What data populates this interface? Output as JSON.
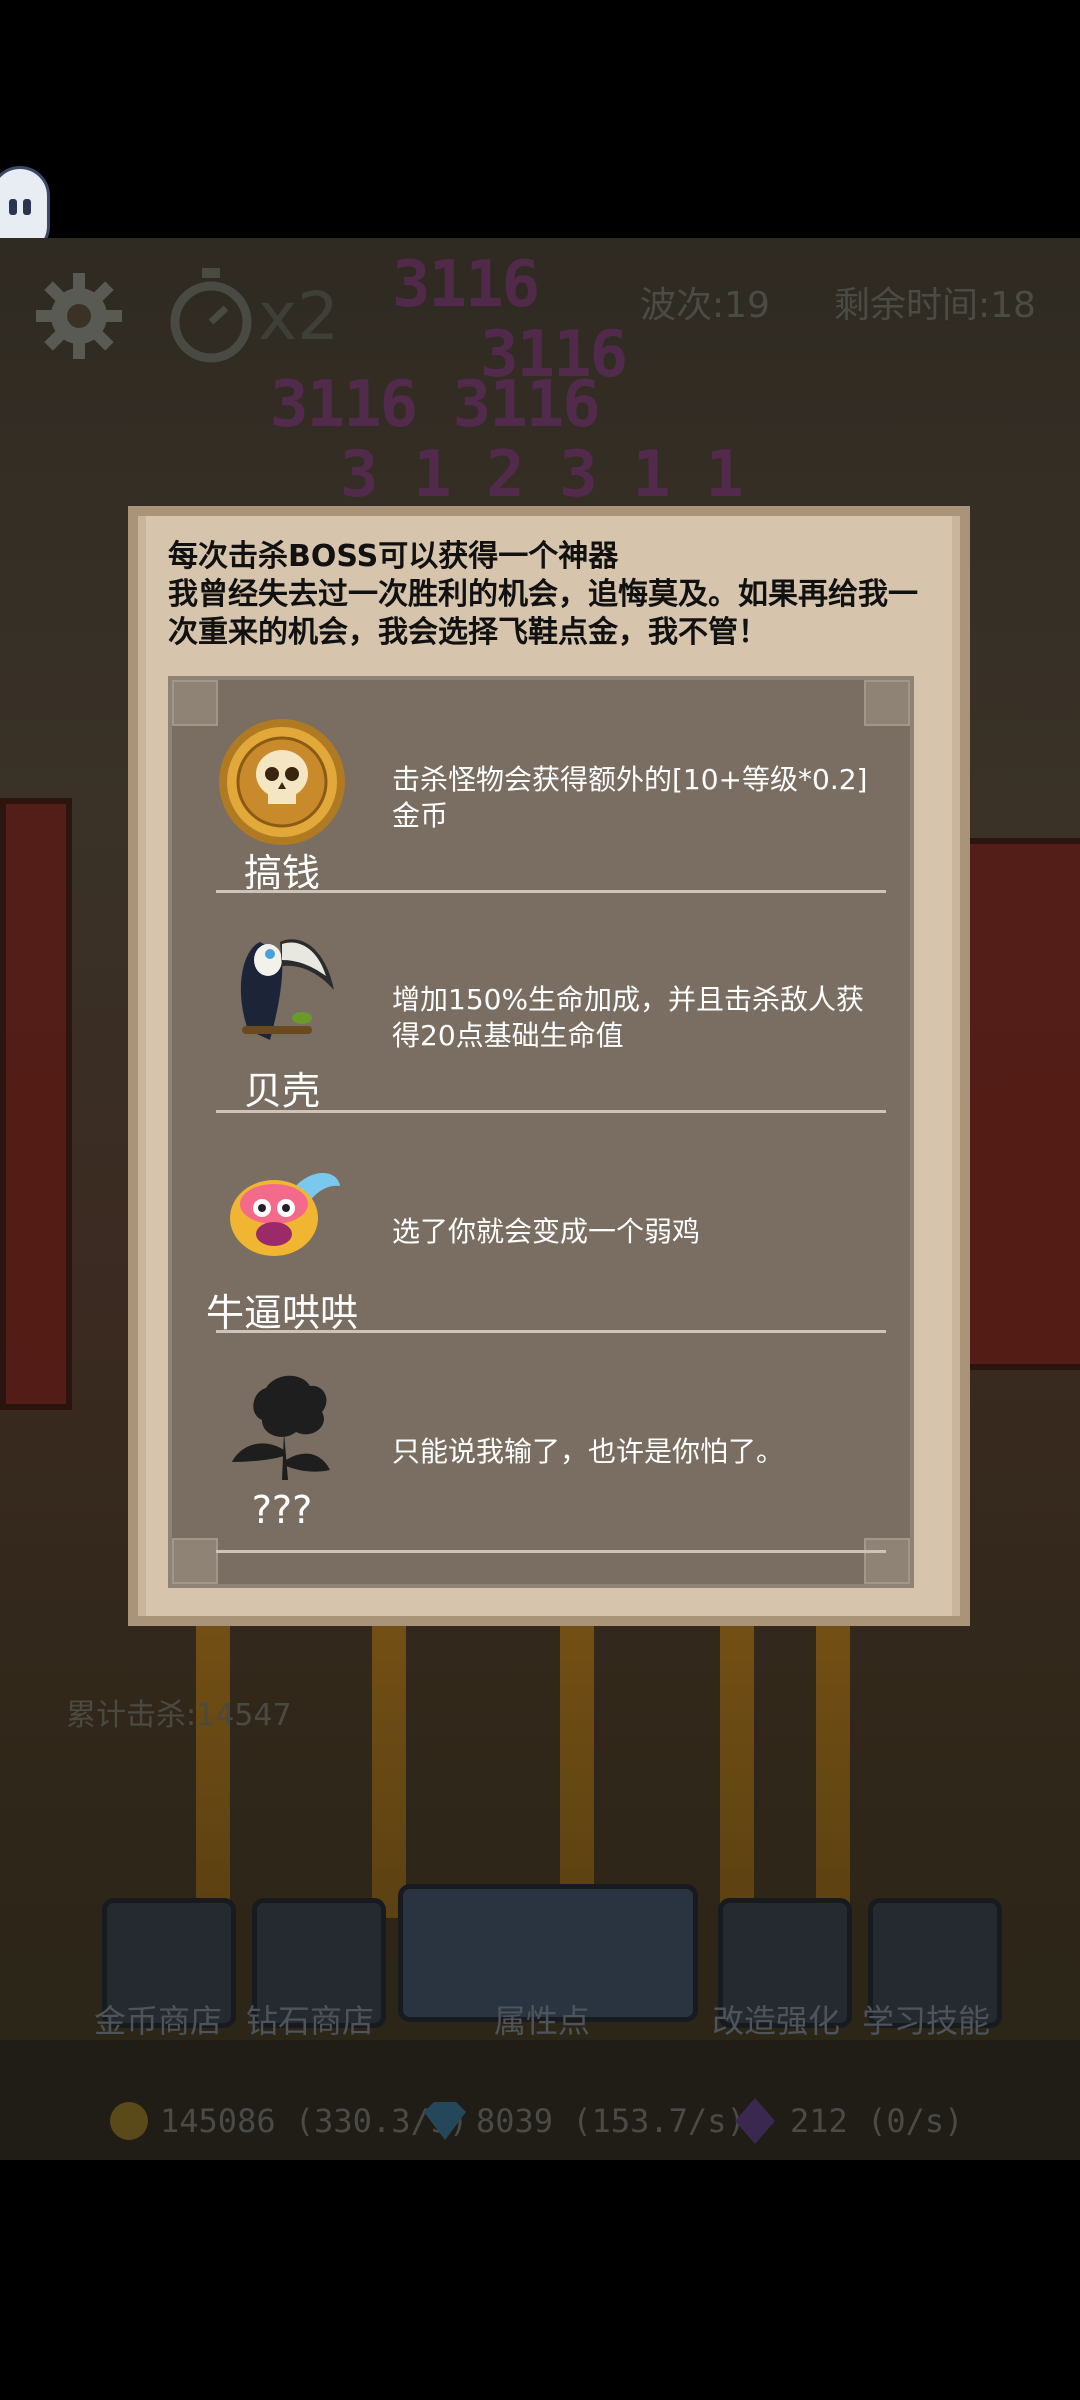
{
  "hud": {
    "speed_label": "x2",
    "wave_label": "波次:19",
    "time_label": "剩余时间:18",
    "kill_label": "累计击杀:14547"
  },
  "bottom_nav": {
    "items": [
      {
        "label": "金币商店"
      },
      {
        "label": "钻石商店"
      },
      {
        "label": "属性点"
      },
      {
        "label": "改造强化"
      },
      {
        "label": "学习技能"
      }
    ]
  },
  "resources": {
    "gold": "145086 (330.3/s)",
    "diamond": "8039 (153.7/s)",
    "crystal": "212 (0/s)"
  },
  "modal": {
    "title_line1": "每次击杀BOSS可以获得一个神器",
    "title_line2": "我曾经失去过一次胜利的机会，追悔莫及。如果再给我一",
    "title_line3": "次重来的机会，我会选择飞鞋点金，我不管！",
    "artifacts": [
      {
        "name": "搞钱",
        "desc": "击杀怪物会获得额外的[10+等级*0.2]金币",
        "icon": "pirate-coin-icon"
      },
      {
        "name": "贝壳",
        "desc": "增加150%生命加成，并且击杀敌人获得20点基础生命值",
        "icon": "toucan-icon"
      },
      {
        "name": "牛逼哄哄",
        "desc": "选了你就会变成一个弱鸡",
        "icon": "winged-bird-icon"
      },
      {
        "name": "???",
        "desc": "只能说我输了，也许是你怕了。",
        "icon": "rose-silhouette-icon"
      }
    ]
  }
}
